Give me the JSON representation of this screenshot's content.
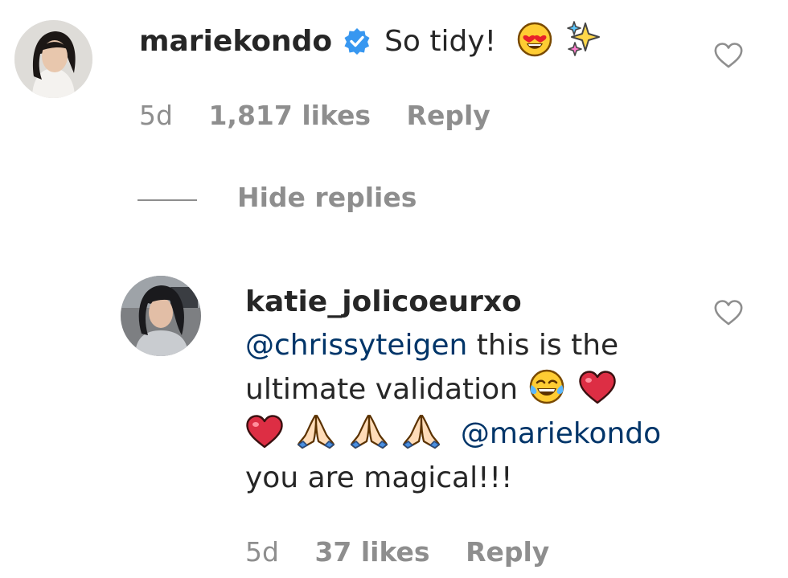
{
  "comment": {
    "username": "mariekondo",
    "verified": true,
    "text": "So tidy!",
    "emojis": [
      "heart-eyes-emoji",
      "sparkles-emoji"
    ],
    "time": "5d",
    "likes": "1,817 likes",
    "reply_label": "Reply"
  },
  "hide_replies_label": "Hide replies",
  "reply": {
    "username": "katie_jolicoeurxo",
    "mention1": "@chrissyteigen",
    "text1": " this is the ultimate validation ",
    "mention2": "@mariekondo",
    "text2": "you are magical!!!",
    "emojis": [
      "tears-of-joy-emoji",
      "red-heart-emoji",
      "red-heart-emoji",
      "folded-hands-emoji",
      "folded-hands-emoji",
      "folded-hands-emoji"
    ],
    "time": "5d",
    "likes": "37 likes",
    "reply_label": "Reply"
  },
  "colors": {
    "text": "#262626",
    "meta": "#8e8e8e",
    "mention": "#003569",
    "verified": "#3897f0",
    "heart_red": "#dd2e44"
  }
}
